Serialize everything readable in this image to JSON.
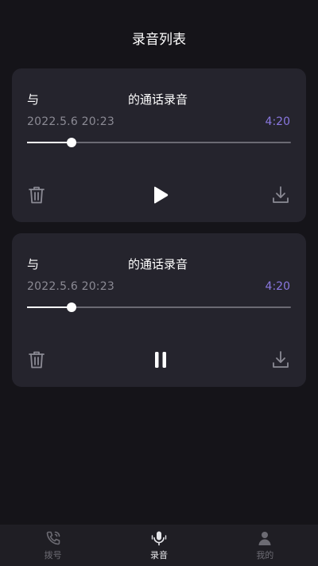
{
  "header": {
    "title": "录音列表"
  },
  "recordings": [
    {
      "name_prefix": "与",
      "name_suffix": "的通话录音",
      "date": "2022.5.6 20:23",
      "duration": "4:20",
      "progress": 0.17,
      "state": "paused",
      "play_icon": "play-icon"
    },
    {
      "name_prefix": "与",
      "name_suffix": "的通话录音",
      "date": "2022.5.6 20:23",
      "duration": "4:20",
      "progress": 0.17,
      "state": "playing",
      "play_icon": "pause-icon"
    }
  ],
  "tabbar": {
    "items": [
      {
        "label": "拨号",
        "icon": "phone-icon",
        "active": false
      },
      {
        "label": "录音",
        "icon": "microphone-icon",
        "active": true
      },
      {
        "label": "我的",
        "icon": "person-icon",
        "active": false
      }
    ]
  },
  "colors": {
    "background": "#151419",
    "card": "#25242d",
    "accent": "#8a78e0",
    "muted_text": "#8b8a94",
    "tabbar": "#1f1e24"
  }
}
